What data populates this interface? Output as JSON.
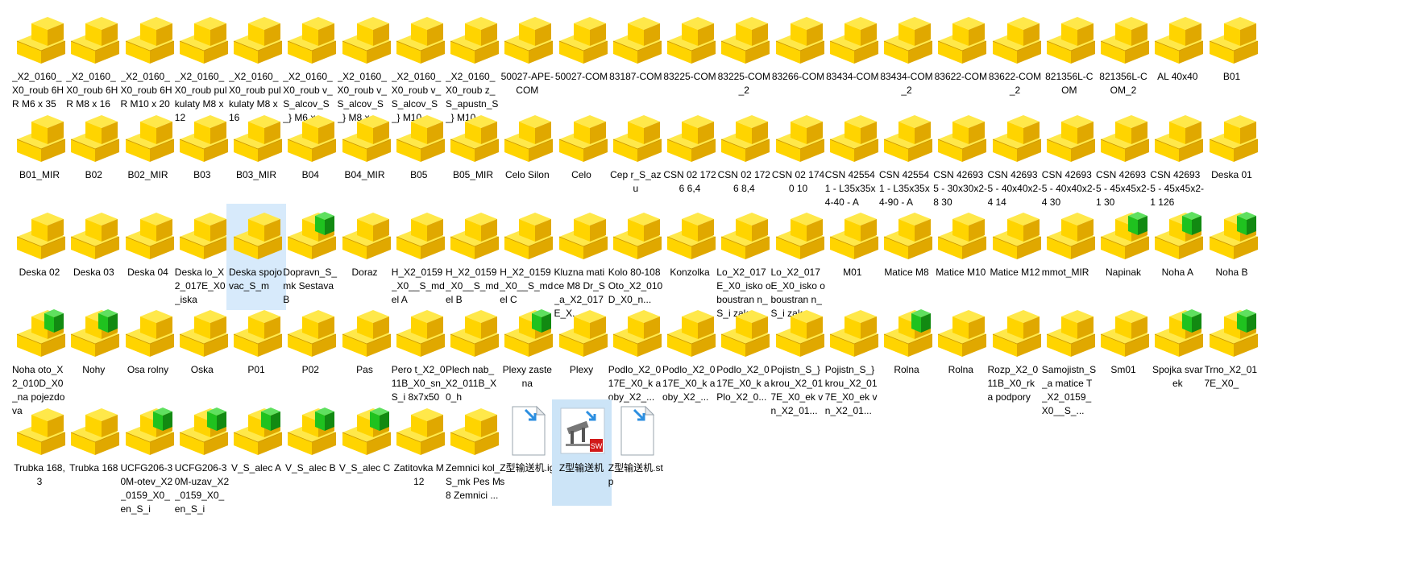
{
  "colors": {
    "part_top": "#ffe84a",
    "part_front": "#ffd400",
    "part_side": "#e0a800",
    "assembly_green": "#1fc21f",
    "selection": "#cce4f7"
  },
  "files": [
    {
      "label": "_X2_0160_X0_roub 6HR M6 x 35",
      "icon": "part-icon",
      "align": "left"
    },
    {
      "label": "_X2_0160_X0_roub 6HR M8 x 16",
      "icon": "part-icon",
      "align": "left"
    },
    {
      "label": "_X2_0160_X0_roub 6HR M10 x 20",
      "icon": "part-icon",
      "align": "left"
    },
    {
      "label": "_X2_0160_X0_roub pulkulaty M8 x 12",
      "icon": "part-icon",
      "align": "left"
    },
    {
      "label": "_X2_0160_X0_roub pulkulaty M8 x 16",
      "icon": "part-icon",
      "align": "left"
    },
    {
      "label": "_X2_0160_X0_roub v_S_alcov_S_} M6 x...",
      "icon": "part-icon",
      "align": "left"
    },
    {
      "label": "_X2_0160_X0_roub v_S_alcov_S_} M8 x...",
      "icon": "part-icon",
      "align": "left"
    },
    {
      "label": "_X2_0160_X0_roub v_S_alcov_S_} M10 ...",
      "icon": "part-icon",
      "align": "left"
    },
    {
      "label": "_X2_0160_X0_roub z_S_apustn_S_} M10...",
      "icon": "part-icon",
      "align": "left"
    },
    {
      "label": "50027-APE-COM",
      "icon": "part-icon",
      "align": "center"
    },
    {
      "label": "50027-COM",
      "icon": "part-icon",
      "align": "center"
    },
    {
      "label": "83187-COM",
      "icon": "part-icon",
      "align": "center"
    },
    {
      "label": "83225-COM",
      "icon": "part-icon",
      "align": "center"
    },
    {
      "label": "83225-COM_2",
      "icon": "part-icon",
      "align": "center"
    },
    {
      "label": "83266-COM",
      "icon": "part-icon",
      "align": "center"
    },
    {
      "label": "83434-COM",
      "icon": "part-icon",
      "align": "center"
    },
    {
      "label": "83434-COM_2",
      "icon": "part-icon",
      "align": "center"
    },
    {
      "label": "83622-COM",
      "icon": "part-icon",
      "align": "center"
    },
    {
      "label": "83622-COM_2",
      "icon": "part-icon",
      "align": "center"
    },
    {
      "label": "821356L-COM",
      "icon": "part-icon",
      "align": "center"
    },
    {
      "label": "821356L-COM_2",
      "icon": "part-icon",
      "align": "center"
    },
    {
      "label": "AL 40x40",
      "icon": "part-icon",
      "align": "center"
    },
    {
      "label": "B01",
      "icon": "part-icon",
      "align": "center"
    },
    {
      "label": "B01_MIR",
      "icon": "part-icon",
      "align": "center"
    },
    {
      "label": "B02",
      "icon": "part-icon",
      "align": "center"
    },
    {
      "label": "B02_MIR",
      "icon": "part-icon",
      "align": "center"
    },
    {
      "label": "B03",
      "icon": "part-icon",
      "align": "center"
    },
    {
      "label": "B03_MIR",
      "icon": "part-icon",
      "align": "center"
    },
    {
      "label": "B04",
      "icon": "part-icon",
      "align": "center"
    },
    {
      "label": "B04_MIR",
      "icon": "part-icon",
      "align": "center"
    },
    {
      "label": "B05",
      "icon": "part-icon",
      "align": "center"
    },
    {
      "label": "B05_MIR",
      "icon": "part-icon",
      "align": "center"
    },
    {
      "label": "Celo Silon",
      "icon": "part-icon",
      "align": "center"
    },
    {
      "label": "Celo",
      "icon": "part-icon",
      "align": "center"
    },
    {
      "label": "Cep r_S_azu",
      "icon": "part-icon",
      "align": "center"
    },
    {
      "label": "CSN 02 1726 6,4",
      "icon": "part-icon",
      "align": "center"
    },
    {
      "label": "CSN 02 1726 8,4",
      "icon": "part-icon",
      "align": "center"
    },
    {
      "label": "CSN 02 1740 10",
      "icon": "part-icon",
      "align": "center"
    },
    {
      "label": "CSN 425541 - L35x35x4-40 - A",
      "icon": "part-icon",
      "align": "left"
    },
    {
      "label": "CSN 425541 - L35x35x4-90 - A",
      "icon": "part-icon",
      "align": "left"
    },
    {
      "label": "CSN 426935 - 30x30x2-8 30",
      "icon": "part-icon",
      "align": "left"
    },
    {
      "label": "CSN 426935 - 40x40x2-4 14",
      "icon": "part-icon",
      "align": "left"
    },
    {
      "label": "CSN 426935 - 40x40x2-4 30",
      "icon": "part-icon",
      "align": "left"
    },
    {
      "label": "CSN 426935 - 45x45x2-1 30",
      "icon": "part-icon",
      "align": "left"
    },
    {
      "label": "CSN 426935 - 45x45x2-1 126",
      "icon": "part-icon",
      "align": "left"
    },
    {
      "label": "Deska 01",
      "icon": "part-icon",
      "align": "center"
    },
    {
      "label": "Deska 02",
      "icon": "part-icon",
      "align": "center"
    },
    {
      "label": "Deska 03",
      "icon": "part-icon",
      "align": "center"
    },
    {
      "label": "Deska 04",
      "icon": "part-icon",
      "align": "center"
    },
    {
      "label": "Deska lo_X2_017E_X0_iska",
      "icon": "part-icon",
      "align": "left"
    },
    {
      "label": "Deska spojovac_S_m",
      "icon": "part-icon",
      "align": "left",
      "state": "selected"
    },
    {
      "label": "Dopravn_S_mk Sestava B",
      "icon": "assembly-icon",
      "align": "left"
    },
    {
      "label": "Doraz",
      "icon": "part-icon",
      "align": "center"
    },
    {
      "label": "H_X2_0159_X0__S_mdel A",
      "icon": "part-icon",
      "align": "left"
    },
    {
      "label": "H_X2_0159_X0__S_mdel B",
      "icon": "part-icon",
      "align": "left"
    },
    {
      "label": "H_X2_0159_X0__S_mdel C",
      "icon": "part-icon",
      "align": "left"
    },
    {
      "label": "Kluzna matice M8 Dr_S_a_X2_017E_X...",
      "icon": "part-icon",
      "align": "left"
    },
    {
      "label": "Kolo 80-108 Oto_X2_010D_X0_n...",
      "icon": "part-icon",
      "align": "left"
    },
    {
      "label": "Konzolka",
      "icon": "part-icon",
      "align": "center"
    },
    {
      "label": "Lo_X2_017E_X0_isko oboustran n_S_i zak...",
      "icon": "part-icon",
      "align": "left"
    },
    {
      "label": "Lo_X2_017E_X0_isko oboustran n_S_i zak...",
      "icon": "part-icon",
      "align": "left"
    },
    {
      "label": "M01",
      "icon": "part-icon",
      "align": "center"
    },
    {
      "label": "Matice M8",
      "icon": "part-icon",
      "align": "center"
    },
    {
      "label": "Matice M10",
      "icon": "part-icon",
      "align": "center"
    },
    {
      "label": "Matice M12",
      "icon": "part-icon",
      "align": "center"
    },
    {
      "label": "mmot_MIR",
      "icon": "part-icon",
      "align": "left"
    },
    {
      "label": "Napinak",
      "icon": "assembly-icon",
      "align": "center"
    },
    {
      "label": "Noha A",
      "icon": "assembly-icon",
      "align": "center"
    },
    {
      "label": "Noha B",
      "icon": "assembly-icon",
      "align": "center"
    },
    {
      "label": "Noha oto_X2_010D_X0_na pojezdova",
      "icon": "assembly-icon",
      "align": "left"
    },
    {
      "label": "Nohy",
      "icon": "assembly-icon",
      "align": "center"
    },
    {
      "label": "Osa rolny",
      "icon": "part-icon",
      "align": "center"
    },
    {
      "label": "Oska",
      "icon": "part-icon",
      "align": "center"
    },
    {
      "label": "P01",
      "icon": "part-icon",
      "align": "center"
    },
    {
      "label": "P02",
      "icon": "part-icon",
      "align": "center"
    },
    {
      "label": "Pas",
      "icon": "part-icon",
      "align": "center"
    },
    {
      "label": "Pero t_X2_011B_X0_sn_S_i 8x7x50",
      "icon": "part-icon",
      "align": "left"
    },
    {
      "label": "Plech nab_X2_011B_X0_h",
      "icon": "part-icon",
      "align": "left"
    },
    {
      "label": "Plexy zastena",
      "icon": "assembly-icon",
      "align": "center"
    },
    {
      "label": "Plexy",
      "icon": "part-icon",
      "align": "center"
    },
    {
      "label": "Podlo_X2_017E_X0_k a oby_X2_...",
      "icon": "part-icon",
      "align": "left"
    },
    {
      "label": "Podlo_X2_017E_X0_k a oby_X2_...",
      "icon": "part-icon",
      "align": "left"
    },
    {
      "label": "Podlo_X2_017E_X0_k a Plo_X2_0...",
      "icon": "part-icon",
      "align": "left"
    },
    {
      "label": "Pojistn_S_} krou_X2_017E_X0_ek vn_X2_01...",
      "icon": "part-icon",
      "align": "left"
    },
    {
      "label": "Pojistn_S_} krou_X2_017E_X0_ek vn_X2_01...",
      "icon": "part-icon",
      "align": "left"
    },
    {
      "label": "Rolna",
      "icon": "assembly-icon",
      "align": "center"
    },
    {
      "label": "Rolna",
      "icon": "part-icon",
      "align": "center"
    },
    {
      "label": "Rozp_X2_011B_X0_rk a podpory",
      "icon": "part-icon",
      "align": "left"
    },
    {
      "label": "Samojistn_S_a matice T_X2_0159_X0__S_...",
      "icon": "part-icon",
      "align": "left"
    },
    {
      "label": "Sm01",
      "icon": "part-icon",
      "align": "center"
    },
    {
      "label": "Spojka svarek",
      "icon": "assembly-icon",
      "align": "center"
    },
    {
      "label": "Trno_X2_017E_X0_",
      "icon": "assembly-icon",
      "align": "left"
    },
    {
      "label": "Trubka 168,3",
      "icon": "part-icon",
      "align": "center"
    },
    {
      "label": "Trubka 168",
      "icon": "part-icon",
      "align": "center"
    },
    {
      "label": "UCFG206-30M-otev_X2_0159_X0_en_S_i",
      "icon": "assembly-icon",
      "align": "left"
    },
    {
      "label": "UCFG206-30M-uzav_X2_0159_X0_en_S_i",
      "icon": "assembly-icon",
      "align": "left"
    },
    {
      "label": "V_S_alec A",
      "icon": "assembly-icon",
      "align": "center"
    },
    {
      "label": "V_S_alec B",
      "icon": "assembly-icon",
      "align": "center"
    },
    {
      "label": "V_S_alec C",
      "icon": "assembly-icon",
      "align": "center"
    },
    {
      "label": "Zatitovka M12",
      "icon": "part-icon",
      "align": "center"
    },
    {
      "label": "Zemnici kol_S_mk Pes M8 Zemnici ...",
      "icon": "part-icon",
      "align": "left"
    },
    {
      "label": "Z型输送机.igs",
      "icon": "igs-file-icon",
      "align": "left"
    },
    {
      "label": "Z型输送机",
      "icon": "solidworks-assembly-icon",
      "align": "center",
      "state": "highlighted"
    },
    {
      "label": "Z型输送机.stp",
      "icon": "stp-file-icon",
      "align": "left"
    }
  ]
}
